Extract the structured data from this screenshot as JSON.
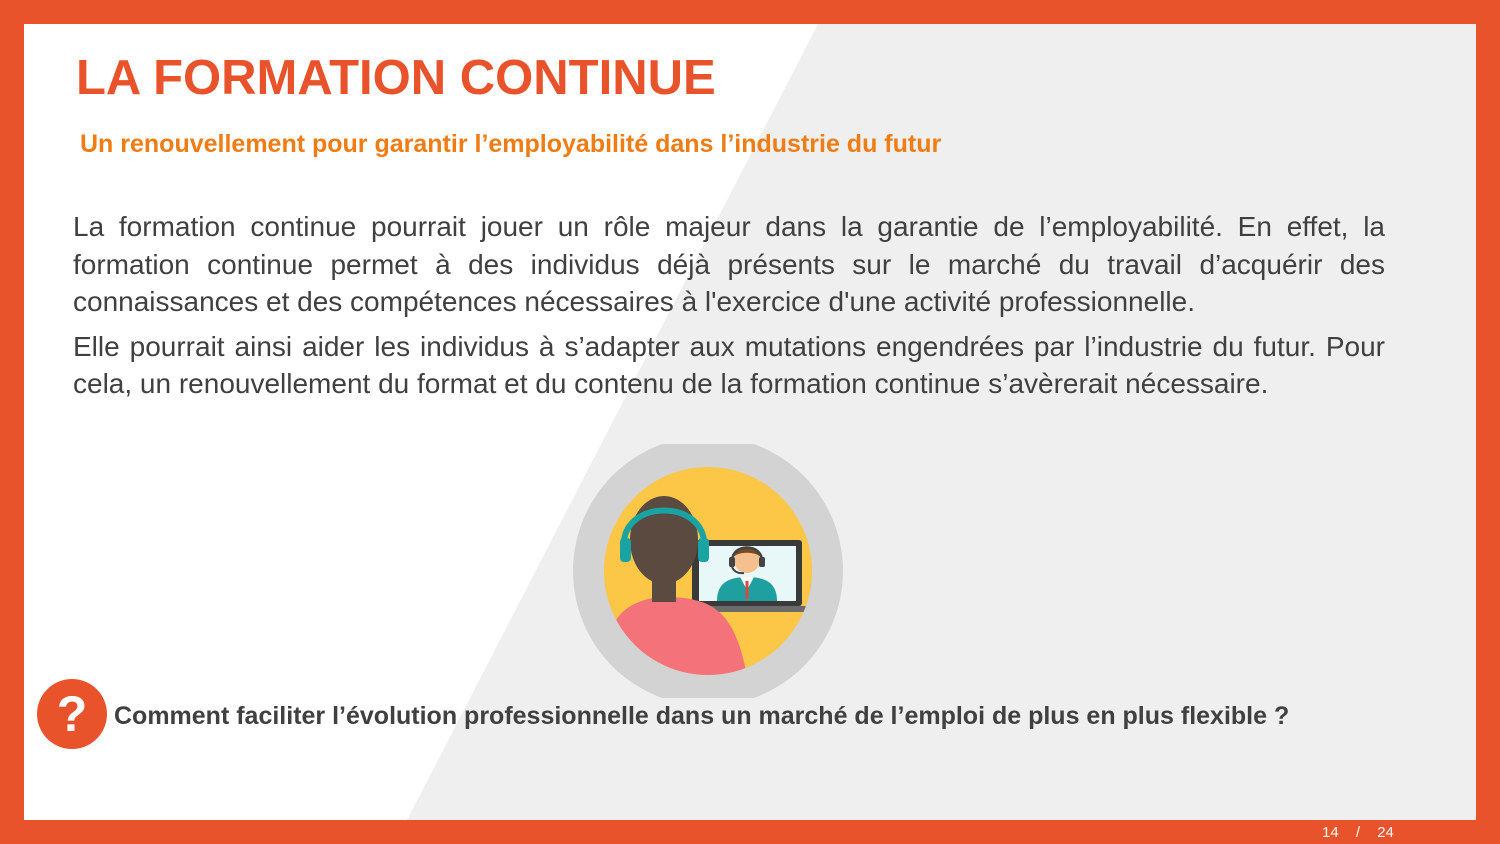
{
  "slide": {
    "title": "LA FORMATION CONTINUE",
    "subtitle": "Un renouvellement pour garantir l’employabilité dans l’industrie du futur",
    "paragraphs": [
      "La formation continue pourrait jouer un rôle majeur dans la garantie de l’employabilité. En effet, la formation continue permet à des individus déjà présents sur le marché du travail d’acquérir des connaissances et des compétences nécessaires à l'exercice d'une activité professionnelle.",
      "Elle pourrait ainsi aider les individus à s’adapter aux mutations engendrées par l’industrie du futur. Pour cela, un renouvellement du format et du contenu de la formation continue s’avèrerait nécessaire."
    ],
    "question_mark": "?",
    "question": "Comment faciliter l’évolution professionnelle dans un marché de l’emploi de plus en plus flexible ?"
  },
  "pagination": {
    "current": "14",
    "separator": "/",
    "total": "24"
  },
  "icons": {
    "illustration": "video-call-icon",
    "question": "question-mark-icon"
  },
  "colors": {
    "frame": "#e8532b",
    "title": "#e8532b",
    "subtitle": "#f07c14",
    "body_text": "#404040",
    "background_shape": "#efefef",
    "illustration_ring": "#d3d3d3",
    "illustration_fill": "#fcc647"
  }
}
